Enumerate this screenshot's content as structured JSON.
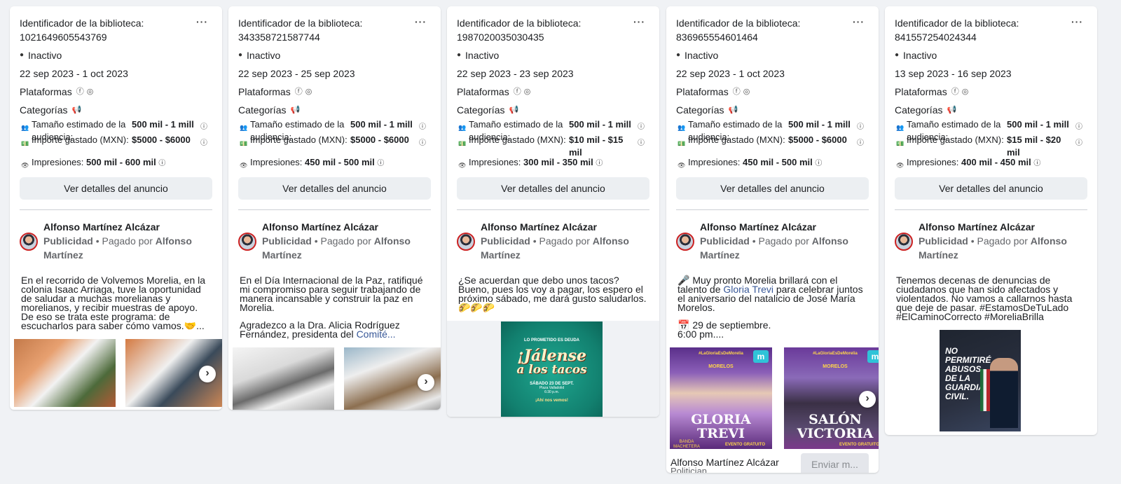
{
  "cards": [
    {
      "library_id_label": "Identificador de la biblioteca: 1021649605543769",
      "status": "Inactivo",
      "dates": "22 sep 2023 - 1 oct 2023",
      "platforms_label": "Plataformas",
      "categories_label": "Categorías",
      "audience_label": "Tamaño estimado de la audiencia:",
      "audience_value": "500 mil - 1 mill",
      "spend_label": "Importe gastado (MXN):",
      "spend_value": "$5000 - $6000",
      "impressions_label": "Impresiones:",
      "impressions_value": "500 mil - 600 mil",
      "details_button": "Ver detalles del anuncio",
      "author_name": "Alfonso Martínez Alcázar",
      "sponsored": "Publicidad",
      "paid_by_prefix": "• Pagado por",
      "paid_by": "Alfonso Martínez",
      "body": [
        "En el recorrido de Volvemos Morelia, en la colonia Isaac Arriaga, tuve la oportunidad de saludar a muchas morelianas y morelianos, y recibir muestras de apoyo. De eso se trata este programa: de escucharlos para saber cómo vamos.🤝..."
      ]
    },
    {
      "library_id_label": "Identificador de la biblioteca: 343358721587744",
      "status": "Inactivo",
      "dates": "22 sep 2023 - 25 sep 2023",
      "platforms_label": "Plataformas",
      "categories_label": "Categorías",
      "audience_label": "Tamaño estimado de la audiencia:",
      "audience_value": "500 mil - 1 mill",
      "spend_label": "Importe gastado (MXN):",
      "spend_value": "$5000 - $6000",
      "impressions_label": "Impresiones:",
      "impressions_value": "450 mil - 500 mil",
      "details_button": "Ver detalles del anuncio",
      "author_name": "Alfonso Martínez Alcázar",
      "sponsored": "Publicidad",
      "paid_by_prefix": "• Pagado por",
      "paid_by": "Alfonso Martínez",
      "body": [
        "En el Día Internacional de la Paz, ratifiqué mi compromiso para seguir trabajando de manera incansable y construir la paz en Morelia.",
        "Agradezco a la Dra. Alicia Rodríguez Fernández, presidenta del"
      ],
      "body_link": "Comité..."
    },
    {
      "library_id_label": "Identificador de la biblioteca: 1987020035030435",
      "status": "Inactivo",
      "dates": "22 sep 2023 - 23 sep 2023",
      "platforms_label": "Plataformas",
      "categories_label": "Categorías",
      "audience_label": "Tamaño estimado de la audiencia:",
      "audience_value": "500 mil - 1 mill",
      "spend_label": "Importe gastado (MXN):",
      "spend_value": "$10 mil - $15 mil",
      "impressions_label": "Impresiones:",
      "impressions_value": "300 mil - 350 mil",
      "details_button": "Ver detalles del anuncio",
      "author_name": "Alfonso Martínez Alcázar",
      "sponsored": "Publicidad",
      "paid_by_prefix": "• Pagado por",
      "paid_by": "Alfonso Martínez",
      "body": [
        "¿Se acuerdan que debo unos tacos? Bueno, pues los voy a pagar, los espero el próximo sábado, me dará gusto saludarlos. 🌮🌮🌮"
      ],
      "poster": {
        "top": "LO PROMETIDO ES DEUDA",
        "title1": "¡Jálense",
        "title2": "a los tacos",
        "date": "SÁBADO 23 DE SEPT.",
        "place": "Plaza Valladolid",
        "time": "6:30 p.m.",
        "bottom": "¡Ahí nos vemos!"
      }
    },
    {
      "library_id_label": "Identificador de la biblioteca: 836965554601464",
      "status": "Inactivo",
      "dates": "22 sep 2023 - 1 oct 2023",
      "platforms_label": "Plataformas",
      "categories_label": "Categorías",
      "audience_label": "Tamaño estimado de la audiencia:",
      "audience_value": "500 mil - 1 mill",
      "spend_label": "Importe gastado (MXN):",
      "spend_value": "$5000 - $6000",
      "impressions_label": "Impresiones:",
      "impressions_value": "450 mil - 500 mil",
      "details_button": "Ver detalles del anuncio",
      "author_name": "Alfonso Martínez Alcázar",
      "sponsored": "Publicidad",
      "paid_by_prefix": "• Pagado por",
      "paid_by": "Alfonso Martínez",
      "body_prefix": "🎤 Muy pronto Morelia brillará con el talento de",
      "body_link": "Gloria Trevi",
      "body_suffix": "para celebrar juntos el aniversario del natalicio de José María Morelos.",
      "body_date": "📅 29 de septiembre.",
      "body_time": "6:00 pm....",
      "poster1_title": "GLORIA TREVI",
      "poster1_sub": "BANDA MACHETERA",
      "poster2_title": "SALÓN VICTORIA",
      "poster_tag": "#LaGloriaEsDeMorelia",
      "poster_venue": "MORELOS",
      "poster_footer": "EVENTO GRATUITO",
      "footer_name": "Alfonso Martínez Alcázar",
      "footer_sub": "Politician",
      "send_button": "Enviar m..."
    },
    {
      "library_id_label": "Identificador de la biblioteca: 841557254024344",
      "status": "Inactivo",
      "dates": "13 sep 2023 - 16 sep 2023",
      "platforms_label": "Plataformas",
      "categories_label": "Categorías",
      "audience_label": "Tamaño estimado de la audiencia:",
      "audience_value": "500 mil - 1 mill",
      "spend_label": "Importe gastado (MXN):",
      "spend_value": "$15 mil - $20 mil",
      "impressions_label": "Impresiones:",
      "impressions_value": "400 mil - 450 mil",
      "details_button": "Ver detalles del anuncio",
      "author_name": "Alfonso Martínez Alcázar",
      "sponsored": "Publicidad",
      "paid_by_prefix": "• Pagado por",
      "paid_by": "Alfonso Martínez",
      "body": [
        "Tenemos decenas de denuncias de ciudadanos que han sido afectados y violentados. No vamos a callarnos hasta que deje de pasar. #EstamosDeTuLado #ElCaminoCorrecto #MoreliaBrilla"
      ],
      "poster_text": "NO PERMITIRÉ ABUSOS DE LA GUARDIA CIVIL."
    }
  ],
  "icons": {
    "status": "check-circle-icon",
    "facebook": "facebook-icon",
    "instagram": "instagram-icon",
    "category": "megaphone-icon",
    "audience": "people-icon",
    "spend": "money-icon",
    "impressions": "eye-icon",
    "info": "info-icon",
    "more": "more-icon",
    "next": "chevron-right-icon"
  },
  "colors": {
    "link": "#385898",
    "button_bg": "#eceff2",
    "page_bg": "#f0f2f5"
  }
}
